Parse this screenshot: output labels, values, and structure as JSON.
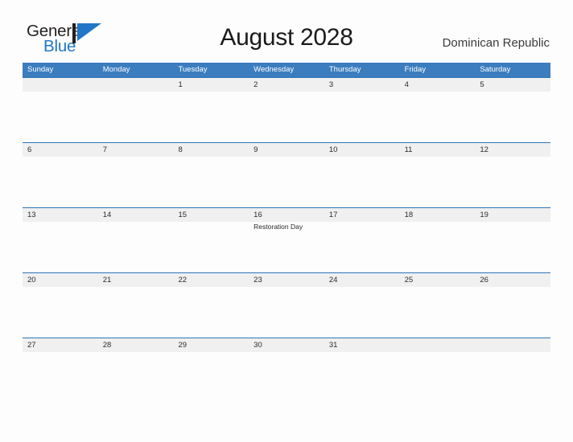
{
  "brand": {
    "name_top": "General",
    "name_bottom": "Blue",
    "flag_icon": "triangle-flag-icon",
    "color_top": "#231f20",
    "color_bottom": "#2176c7"
  },
  "header": {
    "title": "August 2028",
    "region": "Dominican Republic"
  },
  "colors": {
    "header_blue": "#3b7dbf",
    "rule_blue": "#2e75b6",
    "band_gray": "#f0f0f0",
    "page_background": "#fdfdfd",
    "text": "#2b2b2b"
  },
  "calendar": {
    "weekdays": [
      "Sunday",
      "Monday",
      "Tuesday",
      "Wednesday",
      "Thursday",
      "Friday",
      "Saturday"
    ],
    "weeks": [
      {
        "days": [
          {
            "number": "",
            "event": ""
          },
          {
            "number": "",
            "event": ""
          },
          {
            "number": "1",
            "event": ""
          },
          {
            "number": "2",
            "event": ""
          },
          {
            "number": "3",
            "event": ""
          },
          {
            "number": "4",
            "event": ""
          },
          {
            "number": "5",
            "event": ""
          }
        ]
      },
      {
        "days": [
          {
            "number": "6",
            "event": ""
          },
          {
            "number": "7",
            "event": ""
          },
          {
            "number": "8",
            "event": ""
          },
          {
            "number": "9",
            "event": ""
          },
          {
            "number": "10",
            "event": ""
          },
          {
            "number": "11",
            "event": ""
          },
          {
            "number": "12",
            "event": ""
          }
        ]
      },
      {
        "days": [
          {
            "number": "13",
            "event": ""
          },
          {
            "number": "14",
            "event": ""
          },
          {
            "number": "15",
            "event": ""
          },
          {
            "number": "16",
            "event": "Restoration Day"
          },
          {
            "number": "17",
            "event": ""
          },
          {
            "number": "18",
            "event": ""
          },
          {
            "number": "19",
            "event": ""
          }
        ]
      },
      {
        "days": [
          {
            "number": "20",
            "event": ""
          },
          {
            "number": "21",
            "event": ""
          },
          {
            "number": "22",
            "event": ""
          },
          {
            "number": "23",
            "event": ""
          },
          {
            "number": "24",
            "event": ""
          },
          {
            "number": "25",
            "event": ""
          },
          {
            "number": "26",
            "event": ""
          }
        ]
      },
      {
        "days": [
          {
            "number": "27",
            "event": ""
          },
          {
            "number": "28",
            "event": ""
          },
          {
            "number": "29",
            "event": ""
          },
          {
            "number": "30",
            "event": ""
          },
          {
            "number": "31",
            "event": ""
          },
          {
            "number": "",
            "event": ""
          },
          {
            "number": "",
            "event": ""
          }
        ]
      }
    ]
  }
}
